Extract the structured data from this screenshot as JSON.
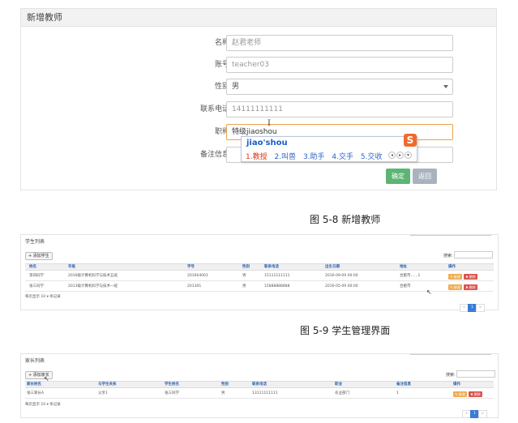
{
  "form": {
    "title": "新增教师",
    "fields": [
      {
        "label": "名称：",
        "value": "赵君老师",
        "dark": false
      },
      {
        "label": "账号：",
        "value": "teacher03",
        "dark": false
      },
      {
        "label": "性别：",
        "value": "男",
        "dark": true
      },
      {
        "label": "联系电话：",
        "value": "14111111111",
        "dark": false
      },
      {
        "label": "职称：",
        "value": "特级jiaoshou",
        "dark": true
      },
      {
        "label": "备注信息：",
        "value": "",
        "dark": false
      }
    ],
    "ok_label": "确定",
    "back_label": "返回",
    "ime": {
      "pinyin": "jiao'shou",
      "candidates": [
        "1.教授",
        "2.叫兽",
        "3.助手",
        "4.交手",
        "5.交收"
      ],
      "logo": "S"
    }
  },
  "captions": {
    "fig1": "图 5-8  新增教师",
    "fig2": "图 5-9 学生管理界面"
  },
  "students": {
    "title": "学生列表",
    "add_label": "+ 添加学生",
    "search_label": "搜索:",
    "headers": [
      "姓名",
      "年级",
      "学号",
      "性别",
      "联系电话",
      "出生日期",
      "地址",
      "操作"
    ],
    "rows": [
      [
        "李四同学",
        "2016级计算机科学与技术五班",
        "201604001",
        "男",
        "15111111111",
        "2016-09-09 00:00",
        "合肥市……1"
      ],
      [
        "张三同学",
        "2013级计算机科学与技术一班",
        "201301",
        "男",
        "15888888888",
        "2016-05-09 00:00",
        "合肥市"
      ]
    ],
    "edit_label": "✎ 修改",
    "del_label": "✖ 删除",
    "footer": "每页显示  10  ▾  条记录",
    "pager": [
      "«",
      "1",
      "»"
    ]
  },
  "parents": {
    "title": "家长列表",
    "add_label": "+ 添加家长",
    "search_label": "搜索:",
    "headers": [
      "家长姓名",
      "与学生关系",
      "学生姓名",
      "性别",
      "联系电话",
      "职业",
      "备注信息",
      "操作"
    ],
    "rows": [
      [
        "张三家长A",
        "父亲1",
        "张三同学",
        "男",
        "13111111111",
        "农业部门",
        "1"
      ]
    ],
    "edit_label": "✎ 修改",
    "del_label": "✖ 删除",
    "footer": "每页显示  10  ▾  条记录",
    "pager": [
      "«",
      "1",
      "»"
    ]
  }
}
